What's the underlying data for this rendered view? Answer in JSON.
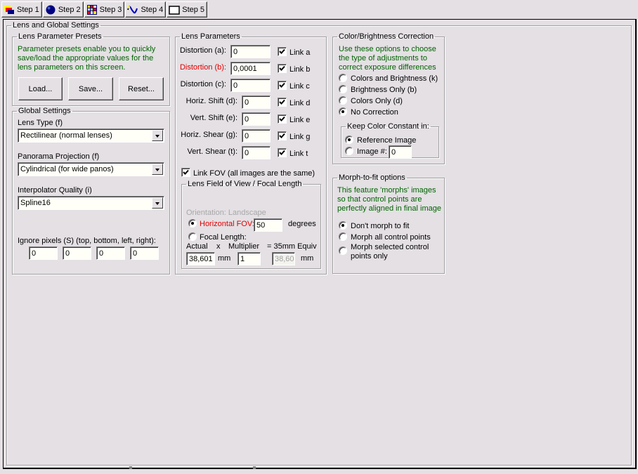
{
  "tabs": [
    {
      "label": "Step 1",
      "icon": "step1-icon"
    },
    {
      "label": "Step 2",
      "icon": "step2-icon"
    },
    {
      "label": "Step 3",
      "icon": "step3-icon"
    },
    {
      "label": "Step 4",
      "icon": "step4-icon"
    },
    {
      "label": "Step 5",
      "icon": "step5-icon"
    }
  ],
  "main": {
    "title": "Lens and Global Settings"
  },
  "presets": {
    "title": "Lens Parameter Presets",
    "description": "Parameter presets enable you to quickly save/load the appropriate values for the lens parameters on this screen.",
    "load_label": "Load...",
    "save_label": "Save...",
    "reset_label": "Reset..."
  },
  "global": {
    "title": "Global Settings",
    "lens_type_label": "Lens Type (f)",
    "lens_type_value": "Rectilinear (normal lenses)",
    "projection_label": "Panorama Projection (f)",
    "projection_value": "Cylindrical (for wide panos)",
    "interpolator_label": "Interpolator Quality (i)",
    "interpolator_value": "Spline16",
    "ignore_label": "Ignore pixels (S) (top, bottom, left, right):",
    "ignore_values": [
      "0",
      "0",
      "0",
      "0"
    ]
  },
  "lens_params": {
    "title": "Lens Parameters",
    "rows": [
      {
        "label": "Distortion (a):",
        "value": "0",
        "link": "Link a",
        "checked": true,
        "highlight": false
      },
      {
        "label": "Distortion (b):",
        "value": "0,0001",
        "link": "Link b",
        "checked": true,
        "highlight": true
      },
      {
        "label": "Distortion (c):",
        "value": "0",
        "link": "Link c",
        "checked": true,
        "highlight": false
      },
      {
        "label": "Horiz. Shift (d):",
        "value": "0",
        "link": "Link d",
        "checked": true,
        "highlight": false
      },
      {
        "label": "Vert. Shift (e):",
        "value": "0",
        "link": "Link e",
        "checked": true,
        "highlight": false
      },
      {
        "label": "Horiz. Shear (g):",
        "value": "0",
        "link": "Link g",
        "checked": true,
        "highlight": false
      },
      {
        "label": "Vert. Shear (t):",
        "value": "0",
        "link": "Link t",
        "checked": true,
        "highlight": false
      }
    ],
    "link_fov_label": "Link FOV (all images are the same)",
    "link_fov_checked": true
  },
  "fov": {
    "title": "Lens Field of View / Focal Length",
    "orientation": "Orientation: Landscape",
    "hfov_label": "Horizontal FOV:",
    "hfov_value": "50",
    "hfov_unit": "degrees",
    "hfov_selected": true,
    "focal_label": "Focal Length:",
    "focal_selected": false,
    "actual_label": "Actual",
    "x_label": "x",
    "multiplier_label": "Multiplier",
    "equiv_label": "= 35mm Equiv",
    "actual_value": "38,601",
    "actual_unit": "mm",
    "multiplier_value": "1",
    "equiv_value": "38,60",
    "equiv_unit": "mm"
  },
  "color": {
    "title": "Color/Brightness Correction",
    "description": "Use these options to choose the type of adjustments to correct exposure differences",
    "options": [
      {
        "label": "Colors and Brightness (k)",
        "selected": false
      },
      {
        "label": "Brightness Only (b)",
        "selected": false
      },
      {
        "label": "Colors Only (d)",
        "selected": false
      },
      {
        "label": "No Correction",
        "selected": true
      }
    ],
    "keep_title": "Keep Color Constant in:",
    "keep_ref_label": "Reference Image",
    "keep_ref_selected": true,
    "keep_img_label": "Image #:",
    "keep_img_selected": false,
    "keep_img_value": "0"
  },
  "morph": {
    "title": "Morph-to-fit options",
    "description": "This feature 'morphs' images so that control points are perfectly aligned in final image",
    "options": [
      {
        "label": "Don't morph to fit",
        "selected": true
      },
      {
        "label": "Morph all control points",
        "selected": false
      },
      {
        "label": "Morph selected control points only",
        "selected": false
      }
    ]
  }
}
